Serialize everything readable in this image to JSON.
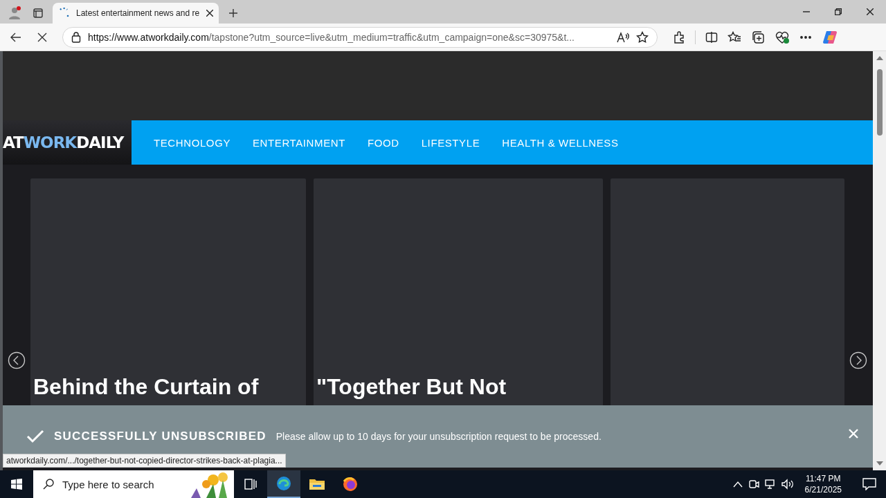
{
  "browser": {
    "tab_title": "Latest entertainment news and re",
    "loading": true,
    "url_host": "https://www.atworkdaily.com",
    "url_path": "/tapstone?utm_source=live&utm_medium=traffic&utm_campaign=one&sc=30975&t..."
  },
  "site": {
    "logo": [
      {
        "text": "AT",
        "color": "#ffffff"
      },
      {
        "text": "WORK",
        "color": "#7ab8ef"
      },
      {
        "text": "DAILY",
        "color": "#ffffff"
      }
    ],
    "nav": [
      "TECHNOLOGY",
      "ENTERTAINMENT",
      "FOOD",
      "LIFESTYLE",
      "HEALTH & WELLNESS"
    ],
    "cards": [
      {
        "kind": "article",
        "title": "Behind the Curtain of"
      },
      {
        "kind": "article",
        "title": "\"Together But Not"
      },
      {
        "kind": "teaser"
      }
    ],
    "notice": {
      "title": "SUCCESSFULLY UNSUBSCRIBED",
      "message": "Please allow up to 10 days for your unsubscription request to be processed."
    },
    "status_url": "atworkdaily.com/.../together-but-not-copied-director-strikes-back-at-plagia..."
  },
  "taskbar": {
    "search_placeholder": "Type here to search",
    "time": "11:47 PM",
    "date": "6/21/2025"
  }
}
